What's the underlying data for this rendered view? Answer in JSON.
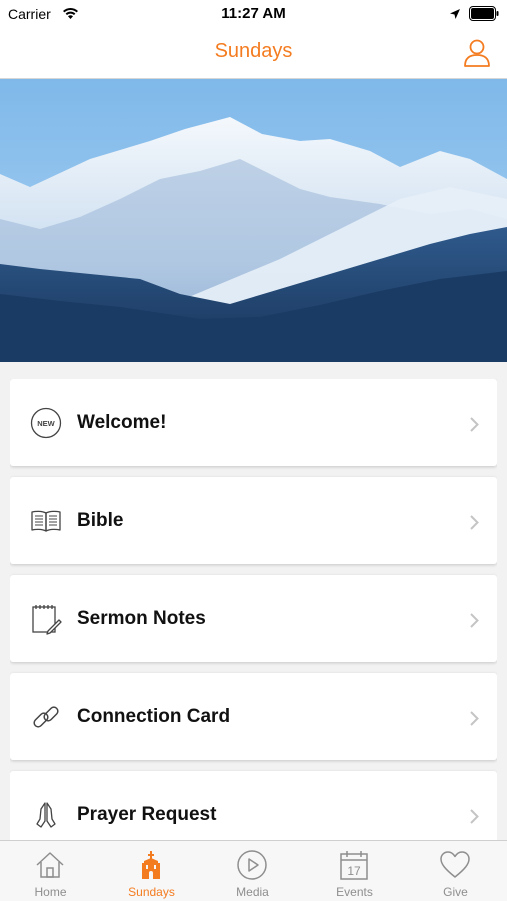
{
  "status": {
    "carrier": "Carrier",
    "time": "11:27 AM"
  },
  "header": {
    "title": "Sundays",
    "profile_icon": "user-icon"
  },
  "hero": {
    "description_icon": "mountain-photo"
  },
  "menu": [
    {
      "label": "Welcome!",
      "icon": "new-badge-icon"
    },
    {
      "label": "Bible",
      "icon": "book-icon"
    },
    {
      "label": "Sermon Notes",
      "icon": "notepad-icon"
    },
    {
      "label": "Connection Card",
      "icon": "link-icon"
    },
    {
      "label": "Prayer Request",
      "icon": "praying-hands-icon"
    }
  ],
  "badge_text": "NEW",
  "tabs": [
    {
      "label": "Home",
      "icon": "home-icon",
      "active": false
    },
    {
      "label": "Sundays",
      "icon": "church-icon",
      "active": true
    },
    {
      "label": "Media",
      "icon": "play-icon",
      "active": false
    },
    {
      "label": "Events",
      "icon": "calendar-icon",
      "active": false,
      "date": "17"
    },
    {
      "label": "Give",
      "icon": "heart-icon",
      "active": false
    }
  ],
  "colors": {
    "accent": "#f47c20",
    "inactive": "#8e8e8e"
  }
}
